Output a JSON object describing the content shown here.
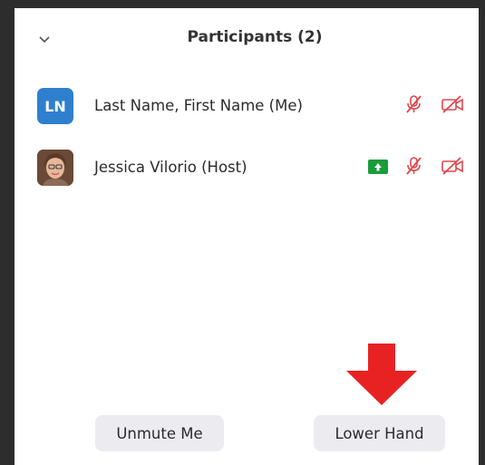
{
  "header": {
    "title": "Participants (2)"
  },
  "participants": [
    {
      "initials": "LN",
      "name": "Last Name, First Name (Me)",
      "avatar_color": "#2f7fcf",
      "mic_icon": "mic-muted-icon",
      "camera_icon": "video-off-icon"
    },
    {
      "name": "Jessica Vilorio (Host)",
      "status_icon": "raised-hand-icon",
      "mic_icon": "mic-muted-icon",
      "camera_icon": "video-off-icon"
    }
  ],
  "footer": {
    "unmute_label": "Unmute Me",
    "lower_hand_label": "Lower Hand"
  },
  "colors": {
    "muted_red": "#e0474c",
    "hand_green": "#1a9c3a",
    "arrow_red": "#e82222",
    "background_dark": "#2d2d2d"
  }
}
